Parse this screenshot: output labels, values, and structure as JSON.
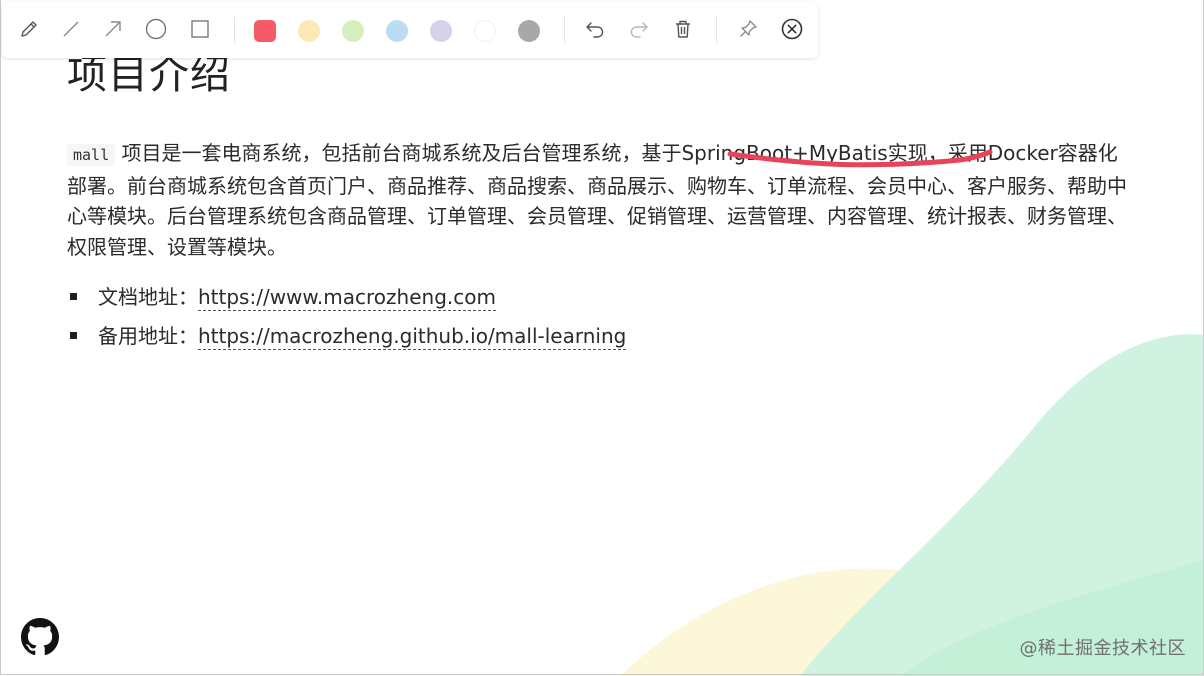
{
  "toolbar": {
    "tools": [
      {
        "name": "pencil-icon"
      },
      {
        "name": "line-icon"
      },
      {
        "name": "arrow-icon"
      },
      {
        "name": "circle-icon"
      },
      {
        "name": "rectangle-icon"
      }
    ],
    "colors": {
      "red": "#f55b66",
      "yellow": "#fde9b7",
      "green": "#d5f0bf",
      "blue": "#bcdcf2",
      "purple": "#d8d1ea",
      "white": "#ffffff",
      "gray": "#a8a8a8"
    },
    "actions": [
      "undo-icon",
      "redo-icon",
      "trash-icon",
      "pin-icon",
      "close-icon"
    ]
  },
  "page": {
    "title": "项目介绍",
    "intro": {
      "code": "mall",
      "text_a": " 项目是一套电商系统，包括前台商城系统及后台管理系统，基于",
      "highlight": "SpringBoot+MyBatis实现",
      "text_b": "，采用Docker容器化部署。前台商城系统包含首页门户、商品推荐、商品搜索、商品展示、购物车、订单流程、会员中心、客户服务、帮助中心等模块。后台管理系统包含商品管理、订单管理、会员管理、促销管理、运营管理、内容管理、统计报表、财务管理、权限管理、设置等模块。"
    },
    "links": [
      {
        "label": "文档地址：",
        "url": "https://www.macrozheng.com"
      },
      {
        "label": "备用地址：",
        "url": "https://macrozheng.github.io/mall-learning"
      }
    ]
  },
  "watermark": "@稀土掘金技术社区",
  "annotation_color": "#e8435a"
}
